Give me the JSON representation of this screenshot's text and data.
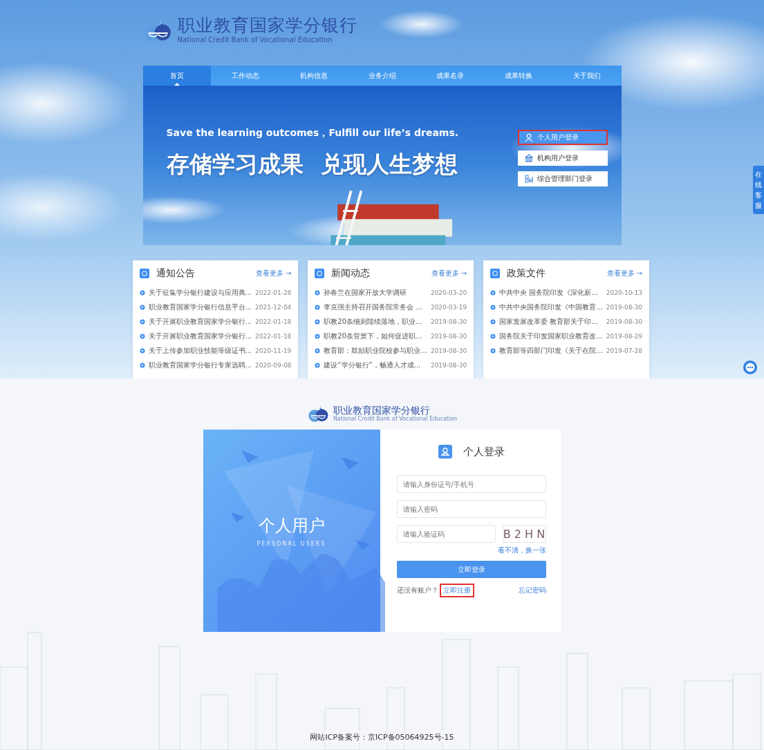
{
  "site": {
    "title": "职业教育国家学分银行",
    "subtitle": "National Credit Bank of Vocational Education"
  },
  "nav": [
    {
      "label": "首页",
      "selected": true
    },
    {
      "label": "工作动态",
      "selected": false
    },
    {
      "label": "机构信息",
      "selected": false
    },
    {
      "label": "业务介绍",
      "selected": false
    },
    {
      "label": "成果名录",
      "selected": false
    },
    {
      "label": "成果转换",
      "selected": false
    },
    {
      "label": "关于我们",
      "selected": false
    }
  ],
  "banner": {
    "tagline": "Save the learning outcomes，Fulfill our life’s dreams.",
    "slogan": "存储学习成果 兑现人生梦想",
    "login_options": [
      {
        "kind": "personal",
        "label": "个人用户登录",
        "selected": true,
        "highlighted": true
      },
      {
        "kind": "institution",
        "label": "机构用户登录",
        "selected": false,
        "highlighted": false
      },
      {
        "kind": "admin",
        "label": "综合管理部门登录",
        "selected": false,
        "highlighted": false
      }
    ]
  },
  "news_sections": [
    {
      "title": "通知公告",
      "more": "查看更多 →",
      "items": [
        {
          "title": "关于征集学分银行建设与应用典...",
          "date": "2022-01-28"
        },
        {
          "title": "职业教育国家学分银行信息平台...",
          "date": "2021-12-04"
        },
        {
          "title": "关于开展职业教育国家学分银行...",
          "date": "2022-01-18"
        },
        {
          "title": "关于开展职业教育国家学分银行...",
          "date": "2022-01-18"
        },
        {
          "title": "关于上传参加职业技能等级证书...",
          "date": "2020-11-19"
        },
        {
          "title": "职业教育国家学分银行专家选聘...",
          "date": "2020-09-08"
        }
      ]
    },
    {
      "title": "新闻动态",
      "more": "查看更多 →",
      "items": [
        {
          "title": "孙春兰在国家开放大学调研",
          "date": "2020-03-20"
        },
        {
          "title": "李克强主持召开国务院常务会 ...",
          "date": "2020-03-19"
        },
        {
          "title": "职教20条细则陆续落地，职业...",
          "date": "2019-08-30"
        },
        {
          "title": "职教20条背景下，如何促进职...",
          "date": "2019-08-30"
        },
        {
          "title": "教育部：鼓励职业院校参与职业...",
          "date": "2019-08-30"
        },
        {
          "title": "建设“学分银行”，畅通人才成...",
          "date": "2019-08-30"
        }
      ]
    },
    {
      "title": "政策文件",
      "more": "查看更多 →",
      "items": [
        {
          "title": "中共中央 国务院印发《深化新...",
          "date": "2020-10-13"
        },
        {
          "title": "中共中央国务院印发《中国教育...",
          "date": "2019-08-30"
        },
        {
          "title": "国家发展改革委 教育部关于印...",
          "date": "2019-08-30"
        },
        {
          "title": "国务院关于印发国家职业教育改...",
          "date": "2019-08-29"
        },
        {
          "title": "教育部等四部门印发《关于在院...",
          "date": "2019-07-28"
        }
      ]
    }
  ],
  "side_tab": {
    "label": "在线客服"
  },
  "login_page": {
    "logo_title": "职业教育国家学分银行",
    "logo_subtitle": "National Credit Bank of Vocational Education",
    "panel_title": "个人用户",
    "panel_subtitle": "PERSONAL USERS",
    "form_title": "个人登录",
    "fields": [
      {
        "kind": "text",
        "placeholder": "请输入身份证号/手机号"
      },
      {
        "kind": "password",
        "placeholder": "请输入密码"
      },
      {
        "kind": "captcha",
        "placeholder": "请输入验证码",
        "captcha": "B 2 H N",
        "refresh": "看不清，换一张"
      }
    ],
    "submit": "立即登录",
    "register_prompt": "还没有账户？",
    "register_link": {
      "label": "立即注册",
      "highlighted": true
    },
    "forgot": "忘记密码"
  },
  "footer": "网站ICP备案号：京ICP备05064925号-15"
}
